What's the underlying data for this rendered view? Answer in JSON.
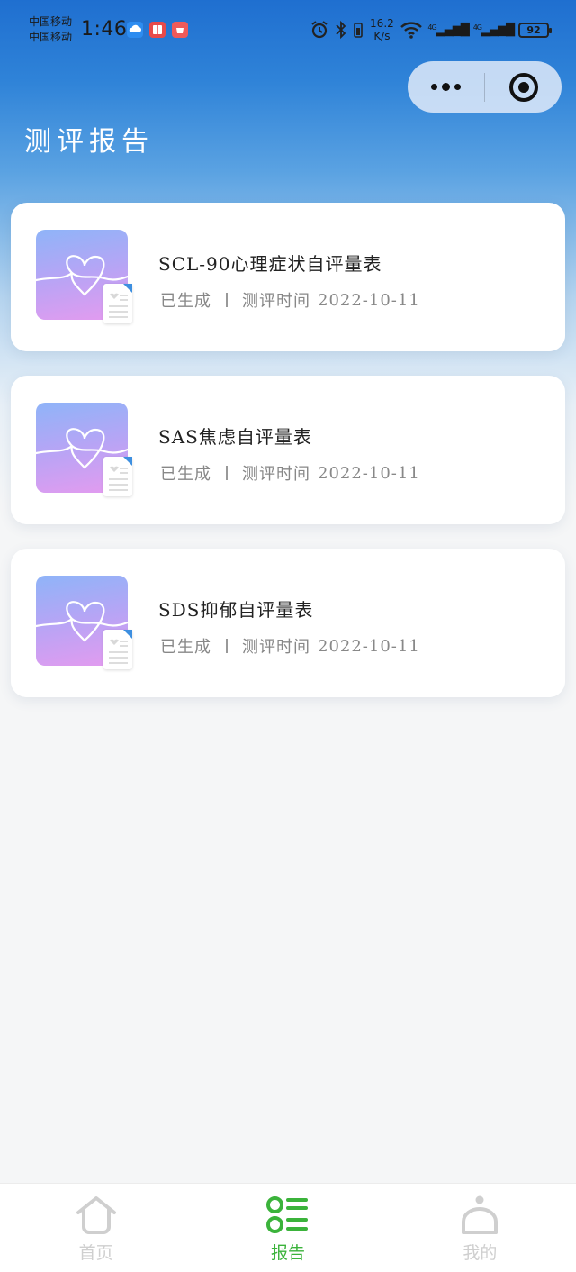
{
  "status_bar": {
    "carrier_1": "中国移动",
    "carrier_2": "中国移动",
    "time": "1:46",
    "net_speed_value": "16.2",
    "net_speed_unit": "K/s",
    "signal_label_1": "4G",
    "signal_label_2": "4G",
    "battery": "92"
  },
  "header": {
    "title": "测评报告"
  },
  "reports": [
    {
      "name": "SCL-90心理症状自评量表",
      "status": "已生成",
      "time_label": "测评时间",
      "date": "2022-10-11"
    },
    {
      "name": "SAS焦虑自评量表",
      "status": "已生成",
      "time_label": "测评时间",
      "date": "2022-10-11"
    },
    {
      "name": "SDS抑郁自评量表",
      "status": "已生成",
      "time_label": "测评时间",
      "date": "2022-10-11"
    }
  ],
  "tab_bar": {
    "home": "首页",
    "report": "报告",
    "mine": "我的",
    "active_color": "#3bb33b",
    "inactive_color": "#cfcfcf"
  }
}
